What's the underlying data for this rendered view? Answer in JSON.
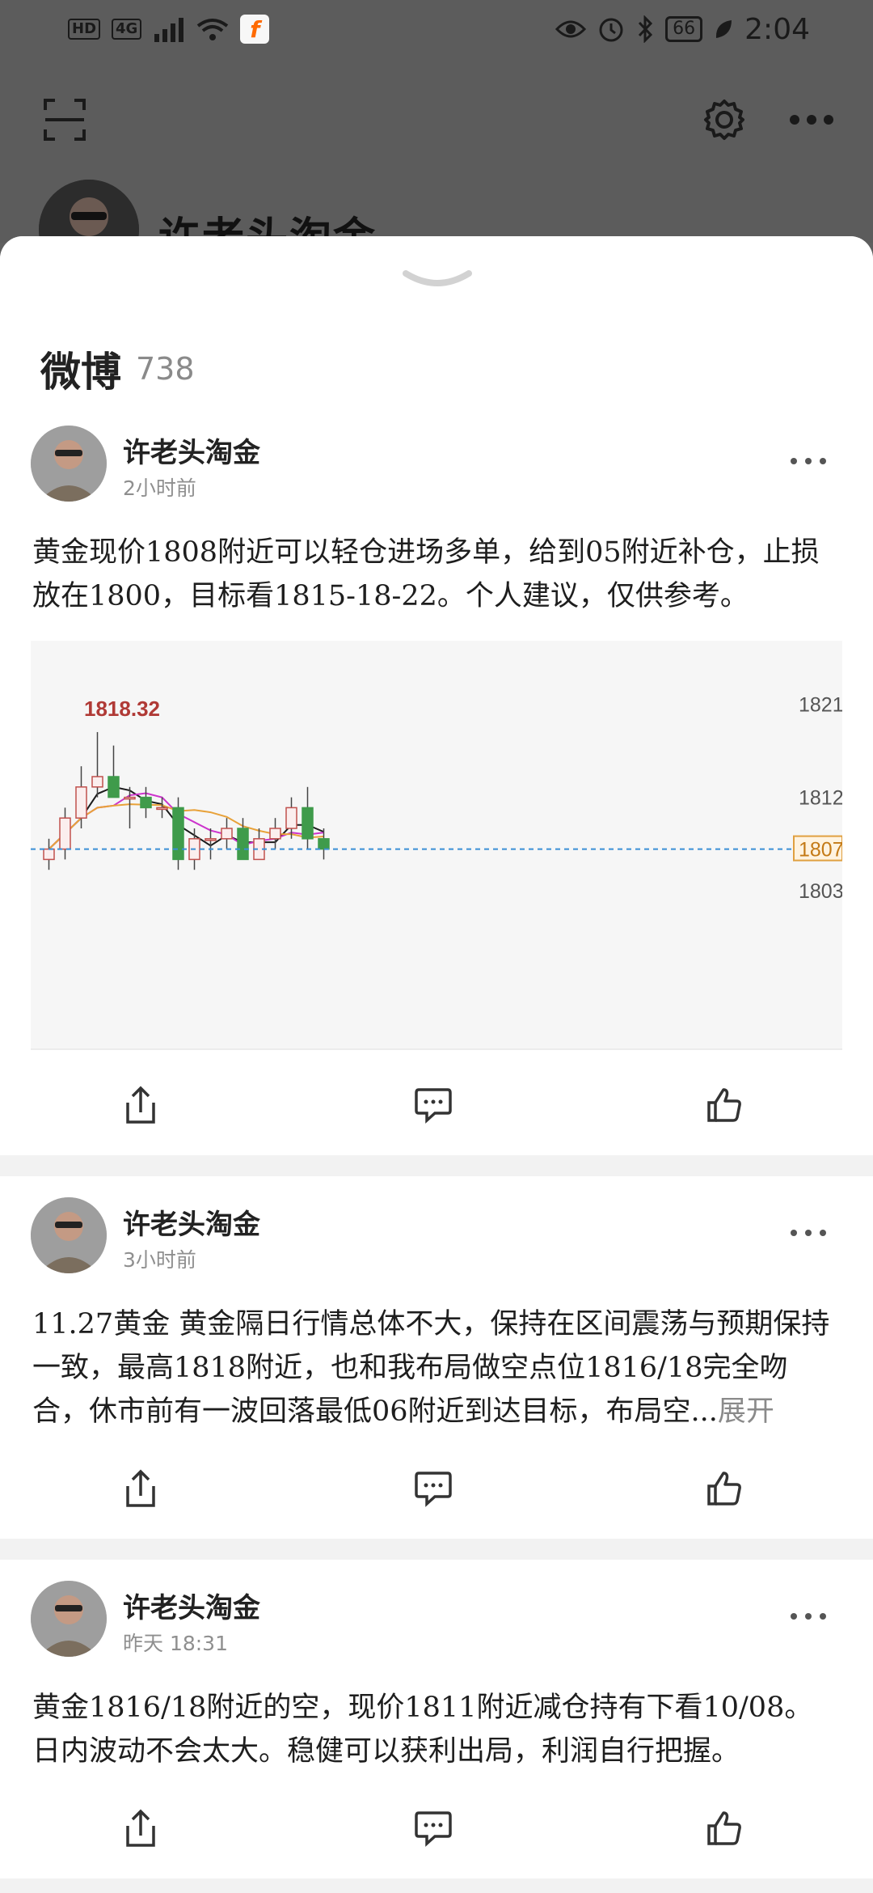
{
  "status_bar": {
    "left_chips": [
      "HD",
      "4G"
    ],
    "battery": "66",
    "time": "2:04"
  },
  "profile": {
    "name": "许老头淘金"
  },
  "sheet": {
    "title": "微博",
    "count": "738"
  },
  "posts": [
    {
      "author": "许老头淘金",
      "time": "2小时前",
      "text": "黄金现价1808附近可以轻仓进场多单，给到05附近补仓，止损放在1800，目标看1815-18-22。个人建议，仅供参考。",
      "has_chart": true
    },
    {
      "author": "许老头淘金",
      "time": "3小时前",
      "text": "11.27黄金 黄金隔日行情总体不大，保持在区间震荡与预期保持一致，最高1818附近，也和我布局做空点位1816/18完全吻合，休市前有一波回落最低06附近到达目标，布局空...",
      "expand_label": "展开"
    },
    {
      "author": "许老头淘金",
      "time": "昨天 18:31",
      "text": "黄金1816/18附近的空，现价1811附近减仓持有下看10/08。日内波动不会太大。稳健可以获利出局，利润自行把握。"
    }
  ],
  "chart_data": {
    "type": "candlestick",
    "high_label": "1818.32",
    "price_tags": [
      "1821",
      "1812",
      "1807",
      "1803"
    ],
    "current_price_line": 1807,
    "ylim": [
      1799,
      1824
    ],
    "candles": [
      {
        "o": 1806,
        "h": 1808,
        "l": 1805,
        "c": 1807
      },
      {
        "o": 1807,
        "h": 1811,
        "l": 1806,
        "c": 1810
      },
      {
        "o": 1810,
        "h": 1815,
        "l": 1809,
        "c": 1813
      },
      {
        "o": 1813,
        "h": 1818.3,
        "l": 1812,
        "c": 1814
      },
      {
        "o": 1814,
        "h": 1817,
        "l": 1812,
        "c": 1812
      },
      {
        "o": 1812,
        "h": 1813,
        "l": 1809,
        "c": 1812
      },
      {
        "o": 1812,
        "h": 1813,
        "l": 1810,
        "c": 1811
      },
      {
        "o": 1811,
        "h": 1812,
        "l": 1810,
        "c": 1811
      },
      {
        "o": 1811,
        "h": 1812,
        "l": 1805,
        "c": 1806
      },
      {
        "o": 1806,
        "h": 1809,
        "l": 1805,
        "c": 1808
      },
      {
        "o": 1808,
        "h": 1809,
        "l": 1806,
        "c": 1808
      },
      {
        "o": 1808,
        "h": 1810,
        "l": 1807,
        "c": 1809
      },
      {
        "o": 1809,
        "h": 1810,
        "l": 1806,
        "c": 1806
      },
      {
        "o": 1806,
        "h": 1809,
        "l": 1806,
        "c": 1808
      },
      {
        "o": 1808,
        "h": 1810,
        "l": 1807,
        "c": 1809
      },
      {
        "o": 1809,
        "h": 1812,
        "l": 1808,
        "c": 1811
      },
      {
        "o": 1811,
        "h": 1813,
        "l": 1807,
        "c": 1808
      },
      {
        "o": 1808,
        "h": 1809,
        "l": 1806,
        "c": 1807
      }
    ],
    "up_color": "#c0504d",
    "down_color": "#3f9b4b",
    "ma_colors": [
      "#1b1b1b",
      "#cc33cc",
      "#e8a23a"
    ]
  }
}
